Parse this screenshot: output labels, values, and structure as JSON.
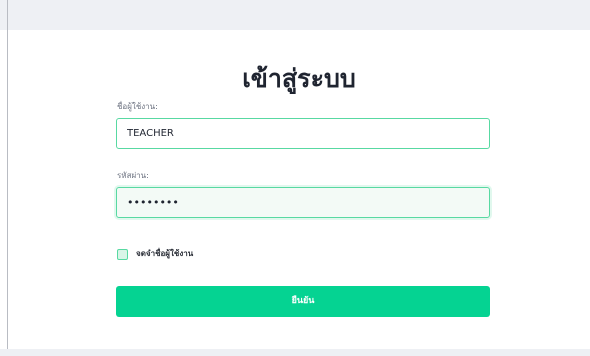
{
  "login": {
    "title": "เข้าสู่ระบบ",
    "username_label": "ชื่อผู้ใช้งาน:",
    "username_value": "TEACHER",
    "password_label": "รหัสผ่าน:",
    "password_value": "••••••••",
    "remember_label": "จดจำชื่อผู้ใช้งาน",
    "remember_checked": false,
    "submit_label": "ยืนยัน"
  },
  "colors": {
    "accent": "#05d392",
    "field_border": "#58d9a2",
    "page_band": "#eef0f4"
  }
}
